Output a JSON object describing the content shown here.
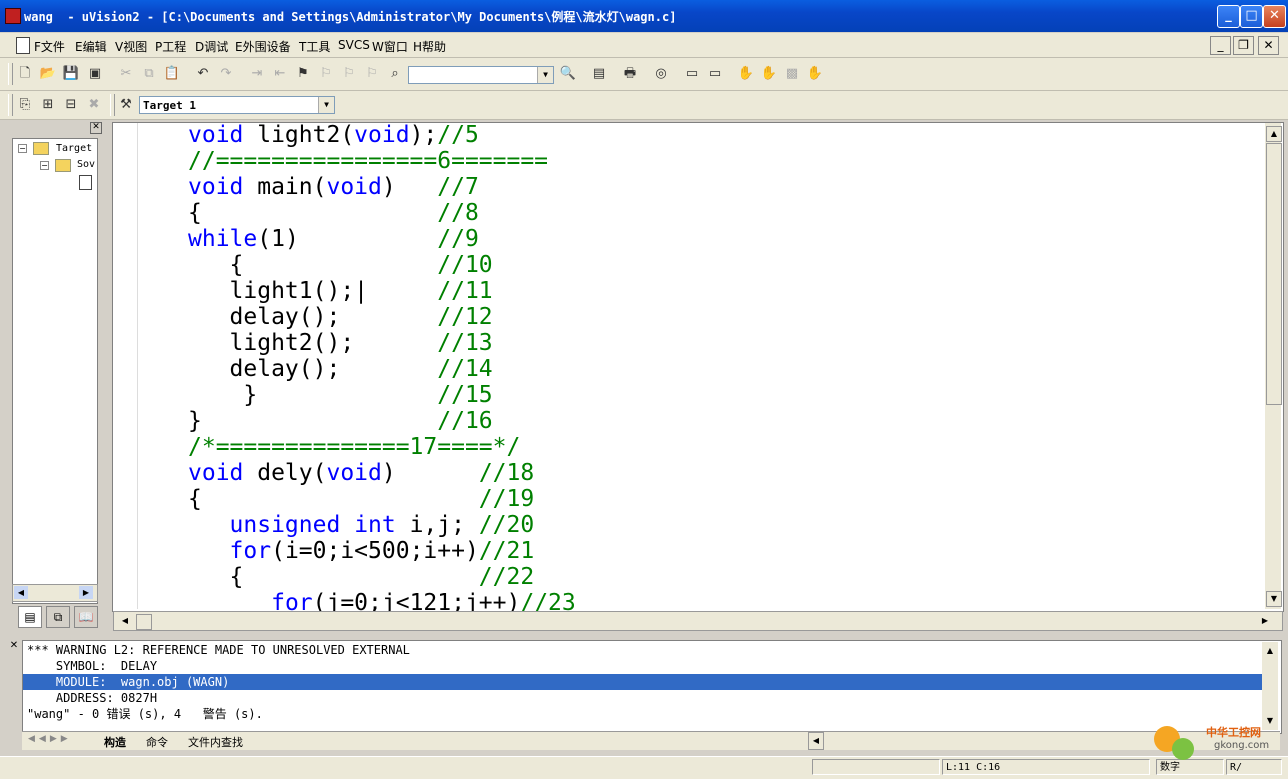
{
  "window": {
    "title": "wang  - uVision2 - [C:\\Documents and Settings\\Administrator\\My Documents\\例程\\流水灯\\wagn.c]",
    "min": "_",
    "max": "□",
    "close": "✕"
  },
  "menu": {
    "items": [
      "F文件",
      "E编辑",
      "V视图",
      "P工程",
      "D调试",
      "E外围设备",
      "T工具",
      "SVCS",
      "W窗口",
      "H帮助"
    ],
    "mdi_min": "_",
    "mdi_restore": "❐",
    "mdi_close": "✕"
  },
  "toolbar2": {
    "target_combo": "Target 1"
  },
  "project_tree": {
    "items": [
      "Target",
      "Sov"
    ]
  },
  "code": [
    [
      [
        "kw",
        "void"
      ],
      [
        "tx",
        " light2("
      ],
      [
        "kw",
        "void"
      ],
      [
        "tx",
        ");"
      ],
      [
        "cm",
        "//5"
      ]
    ],
    [
      [
        "cm",
        "//================6======="
      ]
    ],
    [
      [
        "kw",
        "void"
      ],
      [
        "tx",
        " main("
      ],
      [
        "kw",
        "void"
      ],
      [
        "tx",
        ")   "
      ],
      [
        "cm",
        "//7"
      ]
    ],
    [
      [
        "tx",
        "{                 "
      ],
      [
        "cm",
        "//8"
      ]
    ],
    [
      [
        "kw",
        "while"
      ],
      [
        "tx",
        "(1)          "
      ],
      [
        "cm",
        "//9"
      ]
    ],
    [
      [
        "tx",
        "   {              "
      ],
      [
        "cm",
        "//10"
      ]
    ],
    [
      [
        "tx",
        "   light1();|     "
      ],
      [
        "cm",
        "//11"
      ]
    ],
    [
      [
        "tx",
        "   delay();       "
      ],
      [
        "cm",
        "//12"
      ]
    ],
    [
      [
        "tx",
        "   light2();      "
      ],
      [
        "cm",
        "//13"
      ]
    ],
    [
      [
        "tx",
        "   delay();       "
      ],
      [
        "cm",
        "//14"
      ]
    ],
    [
      [
        "tx",
        "    }             "
      ],
      [
        "cm",
        "//15"
      ]
    ],
    [
      [
        "tx",
        "}                 "
      ],
      [
        "cm",
        "//16"
      ]
    ],
    [
      [
        "cm",
        "/*==============17====*/"
      ]
    ],
    [
      [
        "kw",
        "void"
      ],
      [
        "tx",
        " dely("
      ],
      [
        "kw",
        "void"
      ],
      [
        "tx",
        ")      "
      ],
      [
        "cm",
        "//18"
      ]
    ],
    [
      [
        "tx",
        "{                    "
      ],
      [
        "cm",
        "//19"
      ]
    ],
    [
      [
        "tx",
        "   "
      ],
      [
        "kw",
        "unsigned"
      ],
      [
        "tx",
        " "
      ],
      [
        "kw",
        "int"
      ],
      [
        "tx",
        " i,j; "
      ],
      [
        "cm",
        "//20"
      ]
    ],
    [
      [
        "tx",
        "   "
      ],
      [
        "kw",
        "for"
      ],
      [
        "tx",
        "(i=0;i<500;i++)"
      ],
      [
        "cm",
        "//21"
      ]
    ],
    [
      [
        "tx",
        "   {                 "
      ],
      [
        "cm",
        "//22"
      ]
    ],
    [
      [
        "tx",
        "      "
      ],
      [
        "kw",
        "for"
      ],
      [
        "tx",
        "(j=0;j<121;j++)"
      ],
      [
        "cm",
        "//23"
      ]
    ]
  ],
  "output": {
    "lines": [
      "*** WARNING L2: REFERENCE MADE TO UNRESOLVED EXTERNAL",
      "    SYMBOL:  DELAY",
      "    MODULE:  wagn.obj (WAGN)",
      "    ADDRESS: 0827H",
      "\"wang\" - 0 错误 (s), 4   警告 (s)."
    ],
    "selected_index": 2,
    "tabs": [
      "构造",
      "命令",
      "文件内查找"
    ]
  },
  "status": {
    "position": "L:11 C:16",
    "num": "数字",
    "rw": "R/"
  },
  "watermark": {
    "line1": "中华工控网",
    "line2": "gkong.com"
  },
  "colors": {
    "keyword": "#0000ff",
    "comment": "#008000",
    "selection": "#316ac5",
    "titlebar": "#0a5ee0"
  }
}
